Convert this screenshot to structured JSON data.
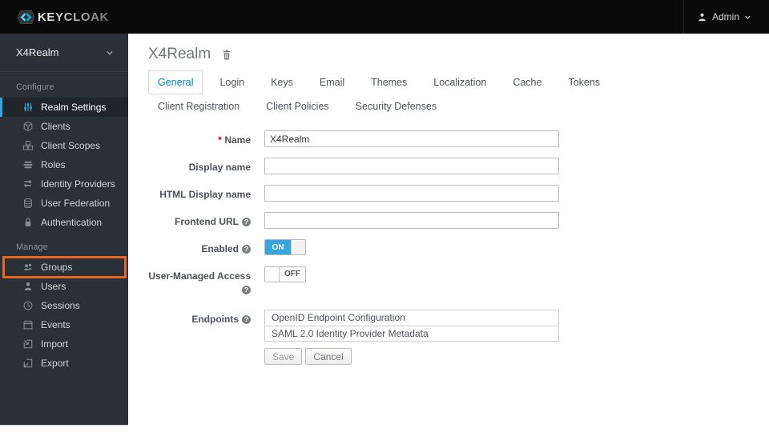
{
  "header": {
    "brand": "KEYCLOAK",
    "user_menu": {
      "label": "Admin"
    }
  },
  "sidebar": {
    "realm_selector": {
      "label": "X4Realm"
    },
    "configure": {
      "title": "Configure",
      "items": [
        {
          "label": "Realm Settings",
          "icon": "sliders-icon"
        },
        {
          "label": "Clients",
          "icon": "cube-icon"
        },
        {
          "label": "Client Scopes",
          "icon": "cubes-icon"
        },
        {
          "label": "Roles",
          "icon": "layers-icon"
        },
        {
          "label": "Identity Providers",
          "icon": "exchange-icon"
        },
        {
          "label": "User Federation",
          "icon": "database-icon"
        },
        {
          "label": "Authentication",
          "icon": "lock-icon"
        }
      ]
    },
    "manage": {
      "title": "Manage",
      "items": [
        {
          "label": "Groups",
          "icon": "users-icon"
        },
        {
          "label": "Users",
          "icon": "user-icon"
        },
        {
          "label": "Sessions",
          "icon": "clock-icon"
        },
        {
          "label": "Events",
          "icon": "calendar-icon"
        },
        {
          "label": "Import",
          "icon": "import-icon"
        },
        {
          "label": "Export",
          "icon": "export-icon"
        }
      ]
    },
    "active_item": "Realm Settings",
    "highlighted_item": "Groups"
  },
  "main": {
    "title": "X4Realm",
    "tabs": [
      "General",
      "Login",
      "Keys",
      "Email",
      "Themes",
      "Localization",
      "Cache",
      "Tokens",
      "Client Registration",
      "Client Policies",
      "Security Defenses"
    ],
    "active_tab": "General",
    "form": {
      "name": {
        "label": "Name",
        "required": true,
        "value": "X4Realm"
      },
      "display_name": {
        "label": "Display name",
        "value": ""
      },
      "html_display_name": {
        "label": "HTML Display name",
        "value": ""
      },
      "frontend_url": {
        "label": "Frontend URL",
        "value": ""
      },
      "enabled": {
        "label": "Enabled",
        "state": "ON"
      },
      "user_managed_access": {
        "label": "User-Managed Access",
        "state": "OFF"
      },
      "endpoints": {
        "label": "Endpoints",
        "links": [
          "OpenID Endpoint Configuration",
          "SAML 2.0 Identity Provider Metadata"
        ]
      },
      "buttons": {
        "save": "Save",
        "cancel": "Cancel"
      }
    }
  },
  "colors": {
    "accent_blue": "#39a5dc",
    "tab_active_blue": "#0088ce",
    "highlight_orange": "#e8671f",
    "required_red": "#cc0000",
    "header_bg": "#0a0a0a",
    "sidebar_bg": "#293038"
  }
}
